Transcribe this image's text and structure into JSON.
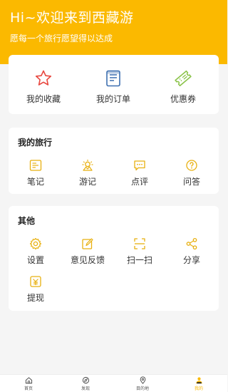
{
  "header": {
    "title": "Hi~欢迎来到西藏游",
    "subtitle": "愿每一个旅行愿望得以达成"
  },
  "quick": [
    {
      "label": "我的收藏",
      "icon": "star-icon"
    },
    {
      "label": "我的订单",
      "icon": "order-icon"
    },
    {
      "label": "优惠券",
      "icon": "coupon-icon"
    }
  ],
  "trip": {
    "title": "我的旅行",
    "items": [
      {
        "label": "笔记",
        "icon": "note-icon"
      },
      {
        "label": "游记",
        "icon": "travelogue-icon"
      },
      {
        "label": "点评",
        "icon": "review-icon"
      },
      {
        "label": "问答",
        "icon": "question-icon"
      }
    ]
  },
  "other": {
    "title": "其他",
    "items": [
      {
        "label": "设置",
        "icon": "gear-icon"
      },
      {
        "label": "意见反馈",
        "icon": "feedback-icon"
      },
      {
        "label": "扫一扫",
        "icon": "scan-icon"
      },
      {
        "label": "分享",
        "icon": "share-icon"
      },
      {
        "label": "提现",
        "icon": "withdraw-icon"
      }
    ]
  },
  "tabbar": [
    {
      "label": "首页",
      "icon": "home-icon"
    },
    {
      "label": "发现",
      "icon": "discover-icon"
    },
    {
      "label": "目的地",
      "icon": "location-icon"
    },
    {
      "label": "我的",
      "icon": "profile-icon"
    }
  ],
  "colors": {
    "accent": "#fbb900",
    "red": "#e8473f",
    "blue": "#3e6fb0",
    "green": "#8bc34a",
    "icon_yellow": "#e8b010"
  }
}
